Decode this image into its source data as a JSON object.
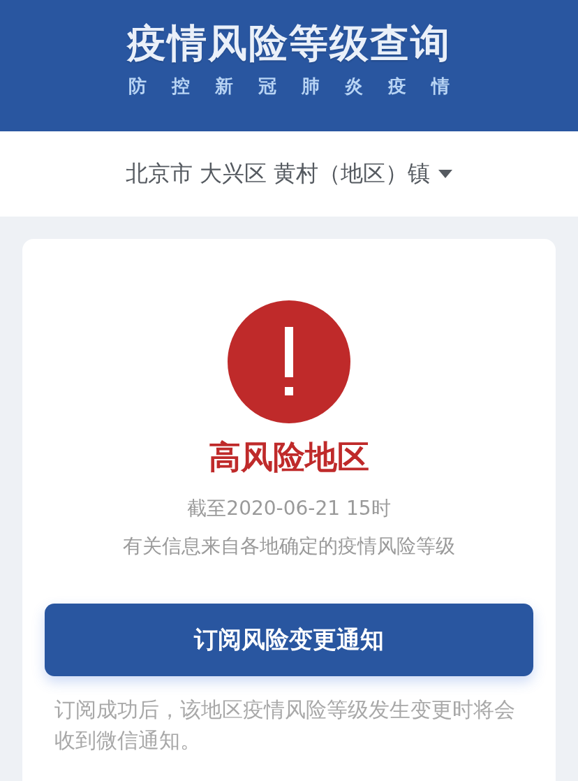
{
  "header": {
    "title": "疫情风险等级查询",
    "subtitle": "防控新冠肺炎疫情"
  },
  "region_selector": {
    "value": "北京市 大兴区 黄村（地区）镇"
  },
  "result": {
    "kind": "high",
    "level_label": "高风险地区",
    "as_of": "截至2020-06-21 15时",
    "source_note": "有关信息来自各地确定的疫情风险等级"
  },
  "subscribe_button": {
    "label": "订阅风险变更通知"
  },
  "subscribe_note": "订阅成功后，该地区疫情风险等级发生变更时将会收到微信通知。"
}
